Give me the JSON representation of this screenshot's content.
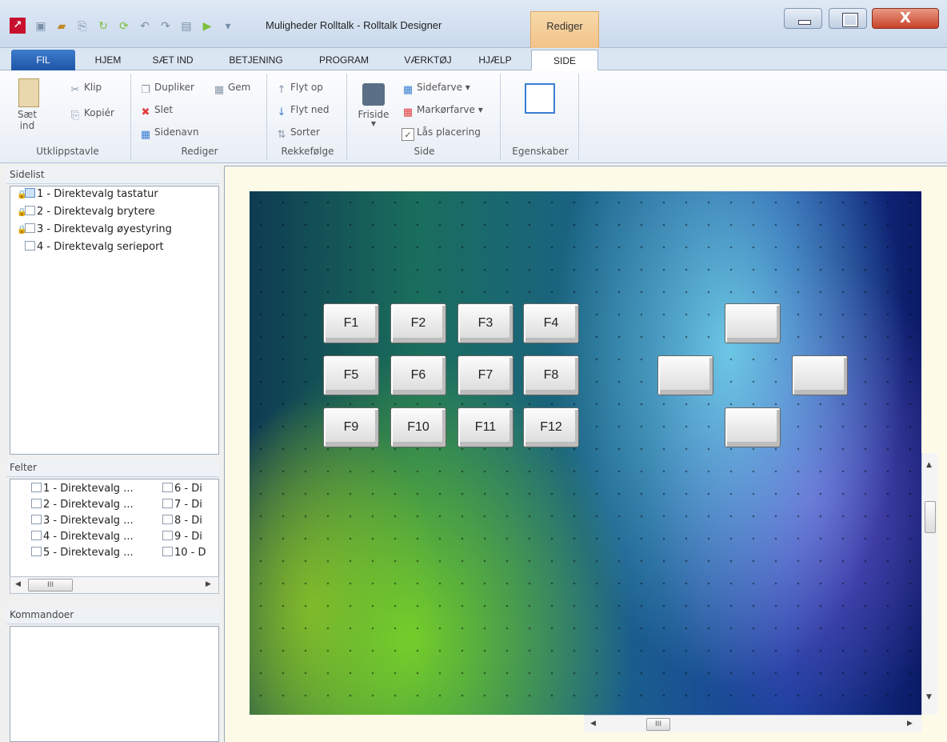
{
  "window": {
    "title": "Muligheder Rolltalk - Rolltalk Designer",
    "context_tab": "Rediger",
    "close_label": "X"
  },
  "ribbon_tabs": [
    "FIL",
    "HJEM",
    "SÆT IND",
    "BETJENING",
    "PROGRAM",
    "VÆRKTØJ",
    "HJÆLP",
    "SIDE"
  ],
  "active_tab": "SIDE",
  "ribbon": {
    "clipboard": {
      "paste": "Sæt ind",
      "cut": "Klip",
      "copy": "Kopiér",
      "label": "Utklippstavle"
    },
    "edit": {
      "duplicate": "Dupliker",
      "save": "Gem",
      "delete": "Slet",
      "pagename": "Sidenavn",
      "label": "Rediger"
    },
    "order": {
      "up": "Flyt op",
      "down": "Flyt ned",
      "sort": "Sorter",
      "label": "Rekkefølge"
    },
    "page": {
      "free": "Friside",
      "pagecolor": "Sidefarve",
      "cursorcolor": "Markørfarve",
      "lock": "Lås placering",
      "label": "Side"
    },
    "props": {
      "label": "Egenskaber"
    }
  },
  "sidelist": {
    "title": "Sidelist",
    "items": [
      {
        "label": "1 - Direktevalg tastatur",
        "locked": true
      },
      {
        "label": "2 - Direktevalg brytere",
        "locked": true
      },
      {
        "label": "3 - Direktevalg øyestyring",
        "locked": true
      },
      {
        "label": "4 - Direktevalg serieport",
        "locked": false
      }
    ]
  },
  "felter": {
    "title": "Felter",
    "col1": [
      "1 - Direktevalg ...",
      "2 - Direktevalg ...",
      "3 - Direktevalg ...",
      "4 - Direktevalg ...",
      "5 - Direktevalg ..."
    ],
    "col2": [
      "6 - Di",
      "7 - Di",
      "8 - Di",
      "9 - Di",
      "10 - D"
    ],
    "scroll_label": "III"
  },
  "kommandoer": {
    "title": "Kommandoer"
  },
  "canvas": {
    "keys": [
      "F1",
      "F2",
      "F3",
      "F4",
      "F5",
      "F6",
      "F7",
      "F8",
      "F9",
      "F10",
      "F11",
      "F12"
    ],
    "scroll_label": "III"
  }
}
